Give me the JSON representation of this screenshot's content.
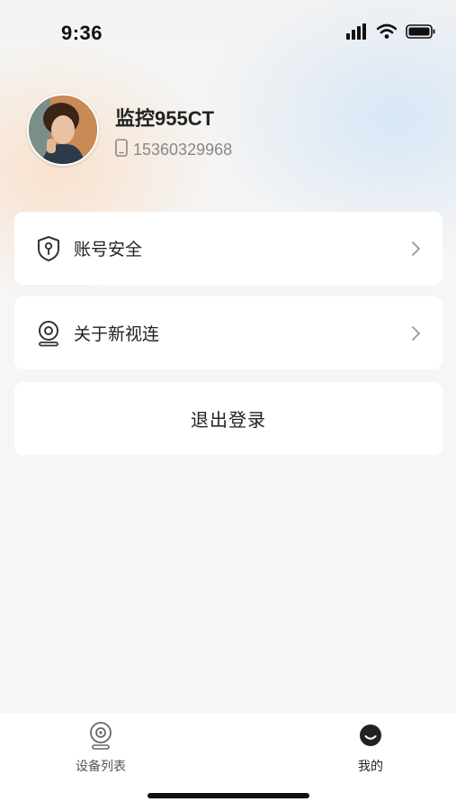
{
  "status_bar": {
    "time": "9:36",
    "icons": [
      "signal-icon",
      "wifi-icon",
      "battery-icon"
    ]
  },
  "profile": {
    "name": "监控955CT",
    "phone": "15360329968",
    "avatar_icon": "avatar-photo"
  },
  "menu": {
    "items": [
      {
        "label": "账号安全",
        "icon": "shield-key-icon"
      },
      {
        "label": "关于新视连",
        "icon": "camera-icon"
      }
    ],
    "logout_label": "退出登录"
  },
  "tabbar": {
    "tabs": [
      {
        "label": "设备列表",
        "icon": "camera-outline-icon",
        "active": false
      },
      {
        "label": "我的",
        "icon": "smile-icon",
        "active": true
      }
    ],
    "active_color": "#222222",
    "inactive_color": "#555555"
  }
}
